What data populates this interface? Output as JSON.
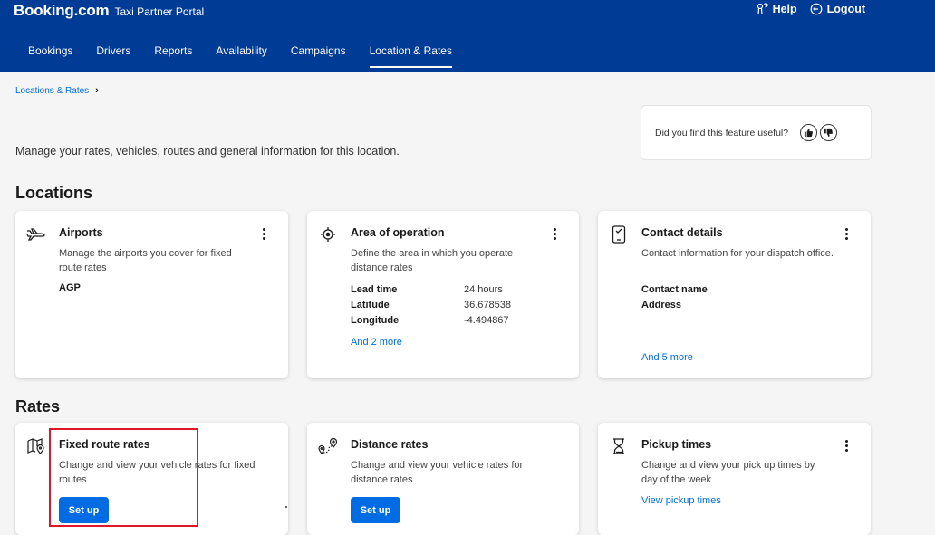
{
  "header": {
    "brand": "Booking.com",
    "portal": "Taxi Partner Portal",
    "help": "Help",
    "logout": "Logout",
    "brand_color": "#003b95"
  },
  "nav": [
    {
      "label": "Bookings",
      "icon": null
    },
    {
      "label": "Drivers",
      "icon": null
    },
    {
      "label": "Reports",
      "icon": null
    },
    {
      "label": "Availability",
      "icon": null
    },
    {
      "label": "Campaigns",
      "icon": null
    },
    {
      "label": "Location & Rates",
      "active": true
    }
  ],
  "breadcrumb": {
    "item": "Locations & Rates"
  },
  "feedback": {
    "question": "Did you find this feature useful?"
  },
  "intro": "Manage your rates, vehicles, routes and general information for this location.",
  "locations": {
    "title": "Locations",
    "airports": {
      "icon": "plane-icon",
      "title": "Airports",
      "description": "Manage the airports you cover for fixed route rates",
      "value": "AGP"
    },
    "area": {
      "icon": "target-icon",
      "title": "Area of operation",
      "description": "Define the area in which you operate distance rates",
      "rows": [
        {
          "label": "Lead time",
          "value": "24 hours"
        },
        {
          "label": "Latitude",
          "value": "36.678538"
        },
        {
          "label": "Longitude",
          "value": "-4.494867"
        }
      ],
      "more": "And 2 more"
    },
    "contact": {
      "icon": "phone-check-icon",
      "title": "Contact details",
      "description": "Contact information for your dispatch office.",
      "fields": [
        "Contact name",
        "Address"
      ],
      "more": "And 5 more"
    }
  },
  "rates": {
    "title": "Rates",
    "fixed": {
      "icon": "map-pin-icon",
      "title": "Fixed route rates",
      "description": "Change and view your vehicle rates for fixed routes",
      "button": "Set up"
    },
    "distance": {
      "icon": "route-icon",
      "title": "Distance rates",
      "description": "Change and view your vehicle rates for distance rates",
      "button": "Set up"
    },
    "pickup": {
      "icon": "hourglass-icon",
      "title": "Pickup times",
      "description": "Change and view your pick up times by day of the week",
      "link": "View pickup times"
    }
  },
  "accent_color": "#006ce4",
  "highlight_color": "#e0162b"
}
